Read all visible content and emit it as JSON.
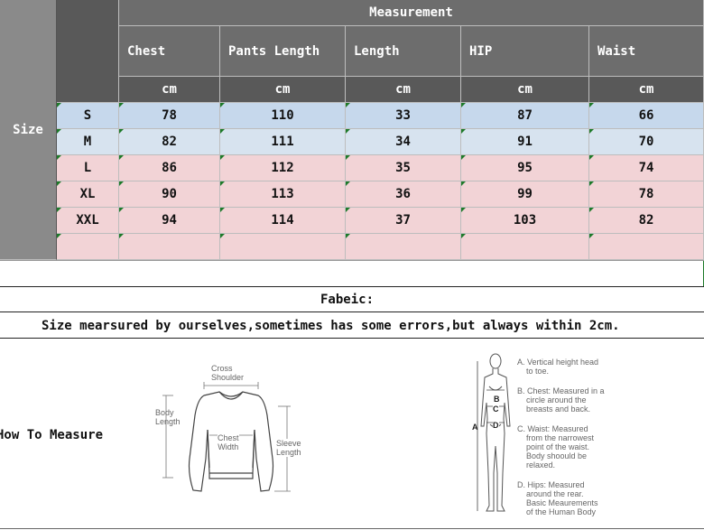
{
  "table": {
    "size_label": "Size",
    "measurement_label": "Measurement",
    "columns": [
      "Chest",
      "Pants Length",
      "Length",
      "HIP",
      "Waist"
    ],
    "unit": "cm",
    "rows": [
      {
        "size": "S",
        "values": [
          "78",
          "110",
          "33",
          "87",
          "66"
        ]
      },
      {
        "size": "M",
        "values": [
          "82",
          "111",
          "34",
          "91",
          "70"
        ]
      },
      {
        "size": "L",
        "values": [
          "86",
          "112",
          "35",
          "95",
          "74"
        ]
      },
      {
        "size": "XL",
        "values": [
          "90",
          "113",
          "36",
          "99",
          "78"
        ]
      },
      {
        "size": "XXL",
        "values": [
          "94",
          "114",
          "37",
          "103",
          "82"
        ]
      }
    ]
  },
  "fabric_label": "Fabeic:",
  "note": "Size mearsured by ourselves,sometimes has some errors,but always within 2cm.",
  "how_to_measure": "How To Measure",
  "sweater_figure": {
    "cross_shoulder": [
      "Cross",
      "Shoulder"
    ],
    "body_length": [
      "Body",
      "Length"
    ],
    "chest_width": [
      "Chest",
      "Width"
    ],
    "sleeve_length": [
      "Sleeve",
      "Length"
    ]
  },
  "body_figure": {
    "markers": [
      "A",
      "B",
      "C",
      "D"
    ],
    "notes": [
      [
        "A. Vertical height head",
        "to toe."
      ],
      [
        "B. Chest: Measured in a",
        "circle around the",
        "breasts and back."
      ],
      [
        "C. Waist: Measured",
        "from the narrowest",
        "point of the waist.",
        "Body shoould be",
        "relaxed."
      ],
      [
        "D. Hips: Measured",
        "around the rear.",
        "Basic Meaurements",
        "of the Human Body"
      ]
    ]
  },
  "colors": {
    "header_gray": "#6d6d6d",
    "left_gray": "#8a8a8a",
    "row_blue": "#c6d8ec",
    "row_pink": "#f2d3d6",
    "tick_green": "#1e7a2a"
  }
}
